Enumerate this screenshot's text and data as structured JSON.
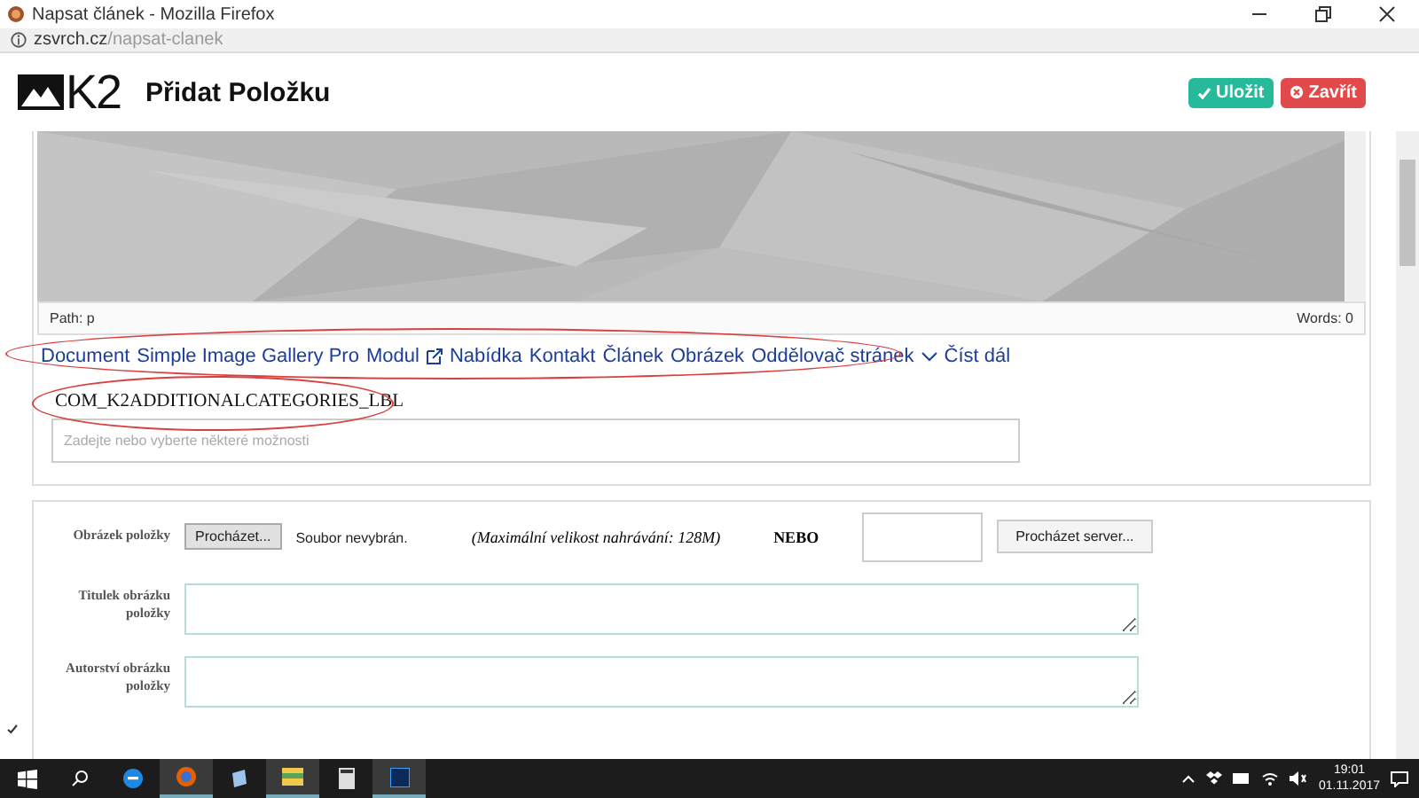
{
  "browser": {
    "title": "Napsat článek - Mozilla Firefox",
    "url_host": "zsvrch.cz",
    "url_path": "/napsat-clanek"
  },
  "header": {
    "logo_text": "K2",
    "title": "Přidat Položku",
    "buttons": [
      {
        "label": "Uložit",
        "kind": "save"
      },
      {
        "label": "Zavřít",
        "kind": "close"
      }
    ]
  },
  "editor": {
    "path_label": "Path:",
    "path_value": "p",
    "words": "Words: 0",
    "plugins": [
      {
        "label": "Document",
        "kind": "plain"
      },
      {
        "label": "Simple Image Gallery Pro",
        "kind": "plain"
      },
      {
        "label": "Modul",
        "kind": "plain"
      },
      {
        "label": "Nabídka",
        "kind": "external"
      },
      {
        "label": "Kontakt",
        "kind": "plain"
      },
      {
        "label": "Článek",
        "kind": "plain"
      },
      {
        "label": "Obrázek",
        "kind": "plain"
      },
      {
        "label": "Oddělovač stránek",
        "kind": "plain"
      },
      {
        "label": "Číst dál",
        "kind": "expand"
      }
    ]
  },
  "categories": {
    "label": "COM_K2ADDITIONALCATEGORIES_LBL",
    "placeholder": "Zadejte nebo vyberte některé možnosti"
  },
  "image_form": {
    "image_label": "Obrázek položky",
    "browse_button": "Procházet...",
    "no_file": "Soubor nevybrán.",
    "max_size": "(Maximální velikost nahrávání: 128M)",
    "or": "NEBO",
    "server_button": "Procházet server...",
    "caption_label": "Titulek obrázku položky",
    "credits_label": "Autorství obrázku položky"
  },
  "taskbar": {
    "time": "19:01",
    "date": "01.11.2017"
  }
}
